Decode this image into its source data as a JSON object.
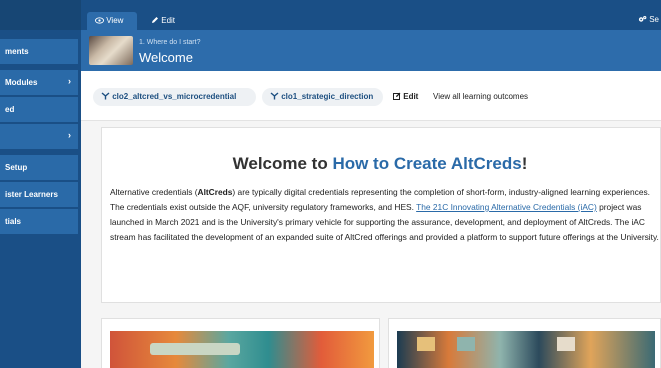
{
  "sidebar": {
    "items": [
      {
        "label": "ments",
        "chevron": false
      },
      {
        "label": "Modules",
        "chevron": true
      },
      {
        "label": "ed",
        "chevron": false
      },
      {
        "label": "",
        "chevron": true
      },
      {
        "label": "Setup",
        "chevron": false
      },
      {
        "label": "ister Learners",
        "chevron": false
      },
      {
        "label": "tials",
        "chevron": false
      }
    ],
    "chevron_glyph": "›"
  },
  "topbar": {
    "view_tab": "View",
    "view_icon": "eye-icon",
    "edit_tab": "Edit",
    "edit_icon": "pencil-icon",
    "settings_text": "Se",
    "settings_icon": "gear-icon"
  },
  "lesson": {
    "subtitle": "1. Where do I start?",
    "title": "Welcome"
  },
  "outcomes": {
    "pills": [
      {
        "label": "clo2_altcred_vs_microcredential",
        "icon": "branch-icon"
      },
      {
        "label": "clo1_strategic_direction",
        "icon": "branch-icon"
      }
    ],
    "edit_label": "Edit",
    "edit_icon": "edit-icon",
    "view_all_label": "View all learning outcomes"
  },
  "welcome": {
    "title_prefix": "Welcome to ",
    "title_highlight": "How to Create AltCreds",
    "title_suffix": "!",
    "body_1": "Alternative credentials (",
    "body_bold": "AltCreds",
    "body_2": ") are typically digital credentials representing the completion of short-form, industry-aligned learning experiences. The credentials exist outside the AQF, university regulatory frameworks, and HES. ",
    "body_link": "The 21C Innovating Alternative Credentials (iAC)",
    "body_3": " project was launched in March 2021 and is the University's primary vehicle for supporting the assurance, development, and deployment of AltCreds. The iAC stream has facilitated the development of an expanded suite of AltCred offerings and provided a platform to support future offerings at the University."
  },
  "colors": {
    "sidebar": "#1a4f86",
    "sidebar_item": "#2a6aa8",
    "header": "#2d6cab",
    "accent": "#2a6aa8"
  }
}
